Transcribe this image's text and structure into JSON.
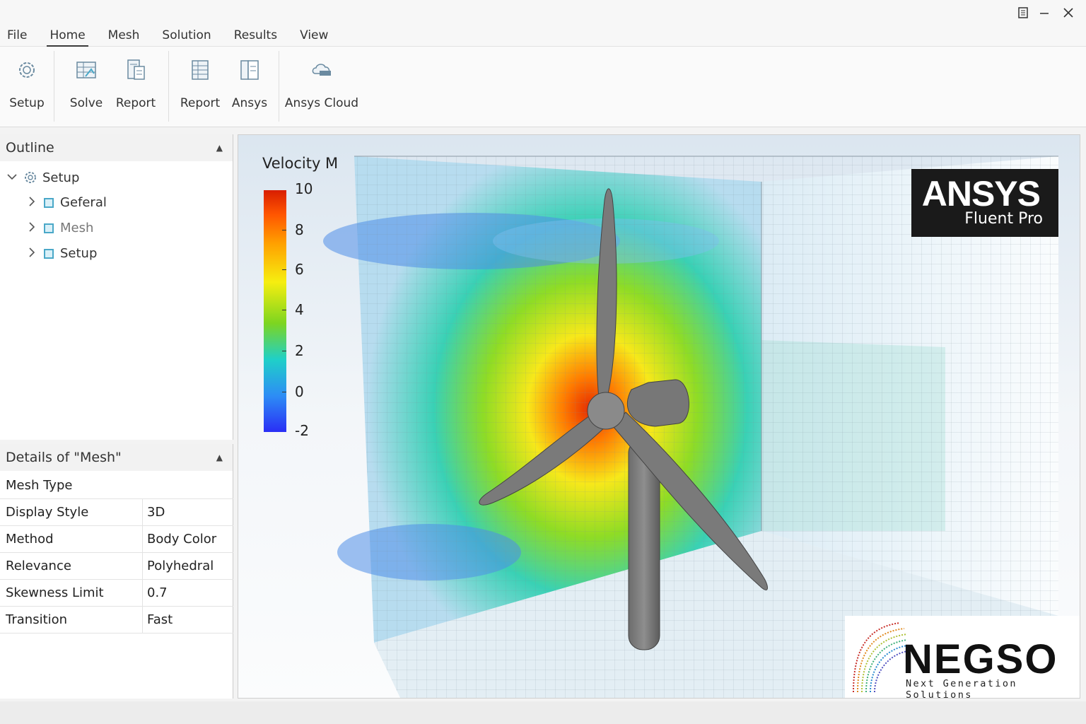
{
  "menu": {
    "items": [
      "File",
      "Home",
      "Mesh",
      "Solution",
      "Results",
      "View"
    ],
    "active": "Home"
  },
  "ribbon": {
    "setup": {
      "label": "Setup",
      "icon": "gear-icon"
    },
    "solve": {
      "label": "Solve",
      "icon": "solve-icon"
    },
    "report1": {
      "label": "Report",
      "icon": "report-icon"
    },
    "report2": {
      "label": "Report",
      "icon": "table-icon"
    },
    "ansys": {
      "label": "Ansys",
      "icon": "book-icon"
    },
    "cloud": {
      "label": "Ansys Cloud",
      "icon": "cloud-icon"
    }
  },
  "outline": {
    "title": "Outline",
    "root": "Setup",
    "children": [
      "Geferal",
      "Mesh",
      "Setup"
    ]
  },
  "details": {
    "title": "Details of \"Mesh\"",
    "section": "Mesh Type",
    "rows": [
      {
        "key": "Display Style",
        "value": "3D"
      },
      {
        "key": "Method",
        "value": "Body Color"
      },
      {
        "key": "Relevance",
        "value": "Polyhedral"
      },
      {
        "key": "Skewness Limit",
        "value": "0.7"
      },
      {
        "key": "Transition",
        "value": "Fast"
      }
    ]
  },
  "viewport": {
    "legend": {
      "title": "Velocity M",
      "ticks": [
        "10",
        "8",
        "6",
        "4",
        "2",
        "0",
        "-2"
      ]
    },
    "ansys_logo": {
      "word": "ANSYS",
      "product": "Fluent Pro"
    },
    "negso_logo": {
      "word": "NEGSO",
      "tagline": "Next Generation Solutions"
    }
  },
  "colors": {
    "accent": "#3a3a3a",
    "panel_header": "#f2f2f2",
    "tree_icon": "#4aa8c8"
  }
}
